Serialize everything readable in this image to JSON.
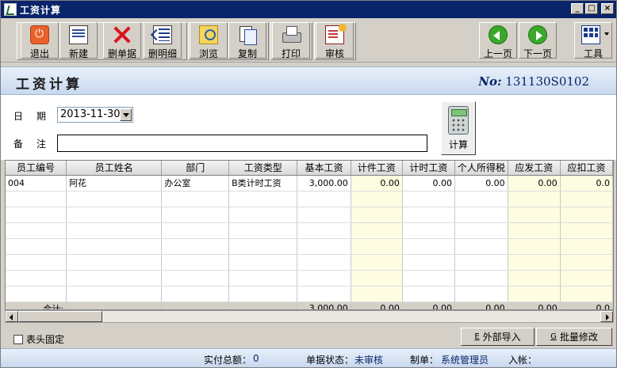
{
  "window": {
    "title": "工资计算"
  },
  "toolbar": {
    "exit": "退出",
    "new": "新建",
    "delete_doc": "删单据",
    "delete_detail": "删明细",
    "browse": "浏览",
    "copy": "复制",
    "print": "打印",
    "audit": "审核",
    "prev_page": "上一页",
    "next_page": "下一页",
    "tools": "工具"
  },
  "header": {
    "title": "工资计算",
    "no_label": "No:",
    "no_value": "131130S0102"
  },
  "form": {
    "date_label": "日期",
    "date_value": "2013-11-30",
    "remark_label": "备注",
    "remark_value": "",
    "calc_label": "计算"
  },
  "grid": {
    "columns": [
      "员工编号",
      "员工姓名",
      "部门",
      "工资类型",
      "基本工资",
      "计件工资",
      "计时工资",
      "个人所得税",
      "应发工资",
      "应扣工资"
    ],
    "rows": [
      [
        "004",
        "阿花",
        "办公室",
        "B类计时工资",
        "3,000.00",
        "0.00",
        "0.00",
        "0.00",
        "0.00",
        "0.0"
      ]
    ],
    "total_label": "合计:",
    "totals": [
      "3,000.00",
      "0.00",
      "0.00",
      "0.00",
      "0.00",
      "0.0"
    ]
  },
  "bottom": {
    "fix_header_label": "表头固定",
    "import_key": "E",
    "import_label": "外部导入",
    "batch_key": "G",
    "batch_label": "批量修改"
  },
  "status": {
    "paid_total_label": "实付总额：",
    "paid_total_value": "0",
    "doc_state_label": "单据状态：",
    "doc_state_value": "未审核",
    "maker_label": "制单：",
    "maker_value": "系统管理员",
    "posted_label": "入帐："
  }
}
